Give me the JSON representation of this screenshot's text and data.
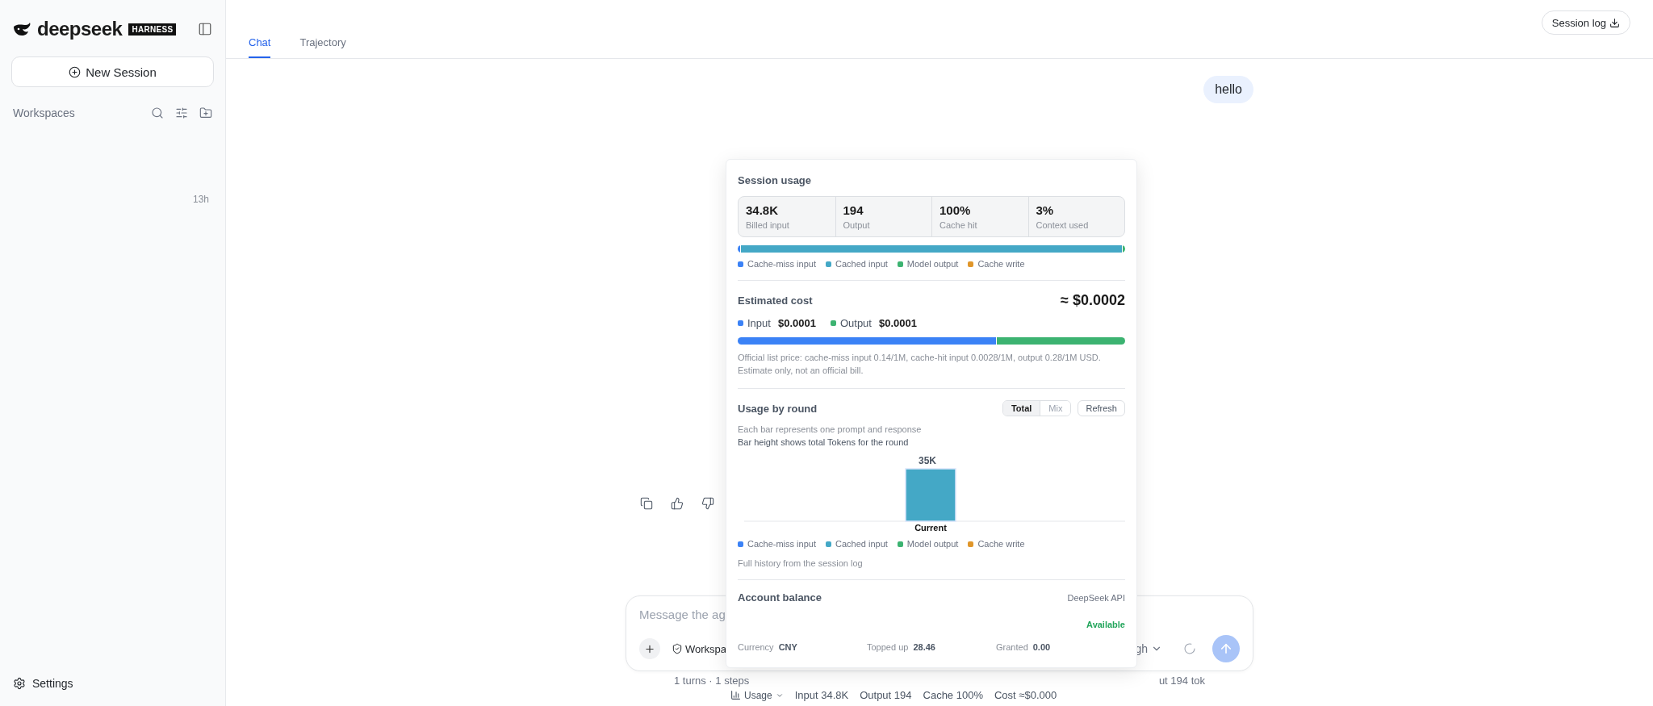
{
  "sidebar": {
    "brand": "deepseek",
    "badge": "HARNESS",
    "new_session": "New Session",
    "workspaces_label": "Workspaces",
    "session_time": "13h",
    "settings": "Settings"
  },
  "tabs": [
    {
      "label": "Chat",
      "selected": true
    },
    {
      "label": "Trajectory",
      "selected": false
    }
  ],
  "session_log_button": "Session log",
  "user_message": "hello",
  "composer": {
    "placeholder": "Message the ag",
    "workspace_button": "Workspa",
    "effort_label": "gh"
  },
  "status_line": {
    "left": "1 turns · 1 steps",
    "right": "ut 194 tok"
  },
  "usage_line": {
    "label": "Usage",
    "items": [
      "Input 34.8K",
      "Output 194",
      "Cache 100%",
      "Cost ≈$0.000"
    ]
  },
  "usage_popup": {
    "session_usage": {
      "title": "Session usage",
      "stats": [
        {
          "value": "34.8K",
          "label": "Billed input"
        },
        {
          "value": "194",
          "label": "Output"
        },
        {
          "value": "100%",
          "label": "Cache hit"
        },
        {
          "value": "3%",
          "label": "Context used"
        }
      ],
      "bar": [
        {
          "color": "#3b82f6",
          "level": 0.003
        },
        {
          "color": "#44a8c6",
          "level": 0.99
        },
        {
          "color": "#3cb371",
          "level": 0.007
        }
      ],
      "legend": [
        {
          "label": "Cache-miss input",
          "color": "#3b82f6"
        },
        {
          "label": "Cached input",
          "color": "#44a8c6"
        },
        {
          "label": "Model output",
          "color": "#3cb371"
        },
        {
          "label": "Cache write",
          "color": "#e0962a"
        }
      ]
    },
    "estimated_cost": {
      "title": "Estimated cost",
      "total": "≈ $0.0002",
      "parts": [
        {
          "label": "Input",
          "value": "$0.0001",
          "color": "#3b82f6",
          "level": 0.667
        },
        {
          "label": "Output",
          "value": "$0.0001",
          "color": "#3cb371",
          "level": 0.333
        }
      ],
      "note": "Official list price: cache-miss input 0.14/1M, cache-hit input 0.0028/1M, output 0.28/1M USD. Estimate only, not an official bill."
    },
    "usage_by_round": {
      "title": "Usage by round",
      "modes": [
        {
          "label": "Total",
          "selected": true
        },
        {
          "label": "Mix",
          "selected": false
        }
      ],
      "refresh": "Refresh",
      "description": "Each bar represents one prompt and response",
      "subtitle": "Bar height shows total Tokens for the round",
      "round_bars": [
        {
          "value_label": "35K",
          "category": "Current"
        }
      ],
      "legend": [
        {
          "label": "Cache-miss input",
          "color": "#3b82f6"
        },
        {
          "label": "Cached input",
          "color": "#44a8c6"
        },
        {
          "label": "Model output",
          "color": "#3cb371"
        },
        {
          "label": "Cache write",
          "color": "#e0962a"
        }
      ],
      "footer": "Full history from the session log"
    },
    "account_balance": {
      "title": "Account balance",
      "provider": "DeepSeek API",
      "status": "Available",
      "fields": [
        {
          "label": "Currency",
          "value": "CNY"
        },
        {
          "label": "Topped up",
          "value": "28.46"
        },
        {
          "label": "Granted",
          "value": "0.00"
        }
      ]
    }
  }
}
